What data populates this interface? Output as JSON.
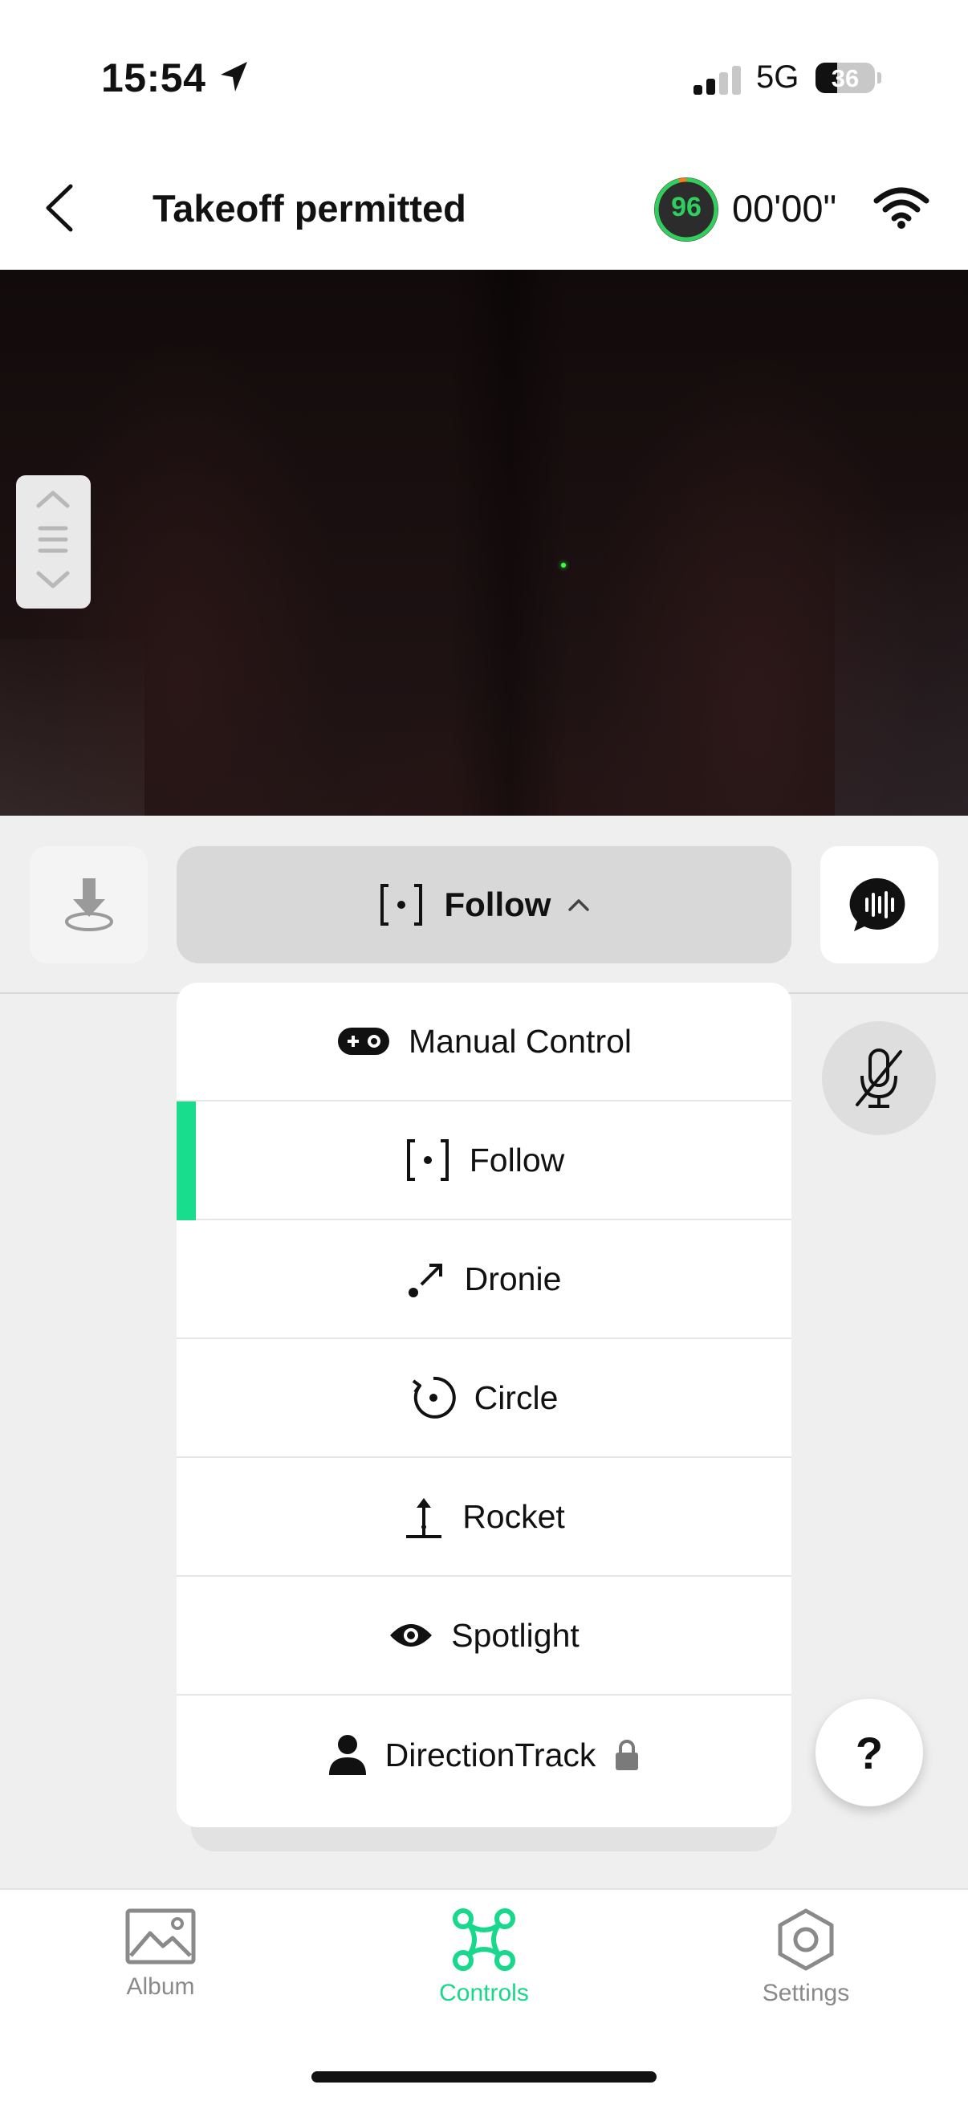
{
  "status_bar": {
    "time": "15:54",
    "network": "5G",
    "battery": "36",
    "battery_level_percent": 36,
    "signal_bars_active": 2,
    "signal_bars_total": 4
  },
  "header": {
    "title": "Takeoff permitted",
    "drone_battery": "96",
    "drone_battery_percent": 96,
    "flight_time": "00'00\"",
    "icons": [
      "back-chevron-icon",
      "wifi-icon"
    ]
  },
  "camera": {
    "icons": [
      "slider-handle-icon"
    ]
  },
  "controls": {
    "mode_button_label": "Follow",
    "icons": [
      "download-icon",
      "follow-icon",
      "chevron-up-icon",
      "voice-icon",
      "mic-off-icon"
    ],
    "help_label": "?"
  },
  "mode_menu": {
    "items": [
      {
        "label": "Manual Control",
        "icon": "gamepad-icon",
        "selected": false,
        "locked": false
      },
      {
        "label": "Follow",
        "icon": "follow-icon",
        "selected": true,
        "locked": false
      },
      {
        "label": "Dronie",
        "icon": "dronie-icon",
        "selected": false,
        "locked": false
      },
      {
        "label": "Circle",
        "icon": "circle-orbit-icon",
        "selected": false,
        "locked": false
      },
      {
        "label": "Rocket",
        "icon": "rocket-icon",
        "selected": false,
        "locked": false
      },
      {
        "label": "Spotlight",
        "icon": "eye-icon",
        "selected": false,
        "locked": false
      },
      {
        "label": "DirectionTrack",
        "icon": "person-icon",
        "selected": false,
        "locked": true
      }
    ]
  },
  "tab_bar": {
    "tabs": [
      {
        "label": "Album",
        "icon": "album-icon",
        "active": false
      },
      {
        "label": "Controls",
        "icon": "drone-icon",
        "active": true
      },
      {
        "label": "Settings",
        "icon": "settings-hexagon-icon",
        "active": false
      }
    ]
  },
  "colors": {
    "accent": "#18dd8c",
    "battery_ring": "#2ecf5f",
    "text": "#111111",
    "muted": "#8a8a8a"
  }
}
